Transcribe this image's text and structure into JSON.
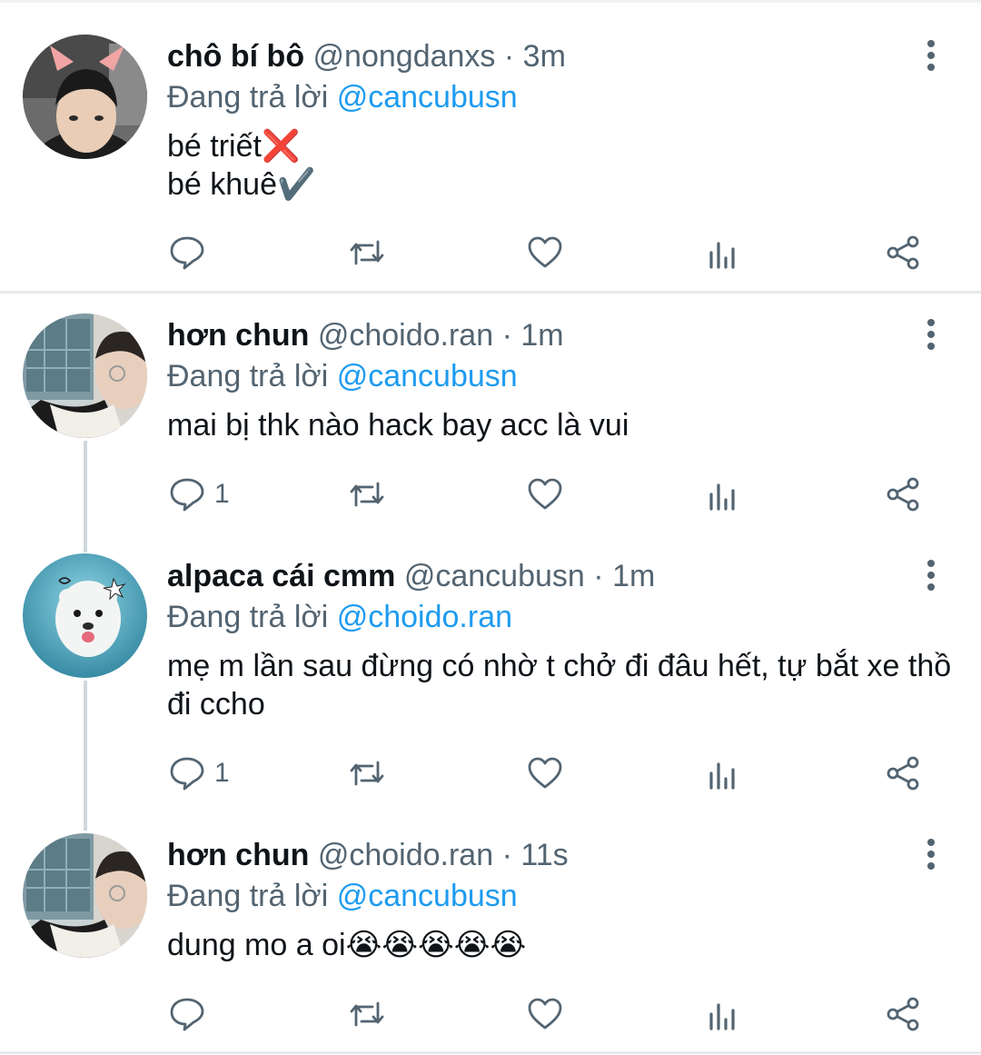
{
  "reply_prefix": "Đang trả lời",
  "tweets": [
    {
      "name": "chô bí bô",
      "handle": "@nongdanxs",
      "separator": "·",
      "time": "3m",
      "reply_to": "@cancubusn",
      "text": "bé triết❌\nbé khuê✔️",
      "reply_count": ""
    },
    {
      "name": "hơn chun",
      "handle": "@choido.ran",
      "separator": "·",
      "time": "1m",
      "reply_to": "@cancubusn",
      "text": "mai bị thk nào hack bay acc là vui",
      "reply_count": "1"
    },
    {
      "name": "alpaca cái cmm",
      "handle": "@cancubusn",
      "separator": "·",
      "time": "1m",
      "reply_to": "@choido.ran",
      "text": "mẹ m lần sau đừng có nhờ t chở đi đâu hết, tự bắt xe thồ đi ccho",
      "reply_count": "1"
    },
    {
      "name": "hơn chun",
      "handle": "@choido.ran",
      "separator": "·",
      "time": "11s",
      "reply_to": "@cancubusn",
      "text": "dung mo a oi😭😭😭😭😭",
      "reply_count": ""
    }
  ],
  "icons": {
    "reply": "reply-icon",
    "retweet": "retweet-icon",
    "like": "heart-icon",
    "analytics": "analytics-icon",
    "share": "share-icon",
    "more": "more-vertical-icon"
  },
  "colors": {
    "mention": "#1d9bf0",
    "secondary_text": "#536471",
    "icon": "#536471"
  }
}
